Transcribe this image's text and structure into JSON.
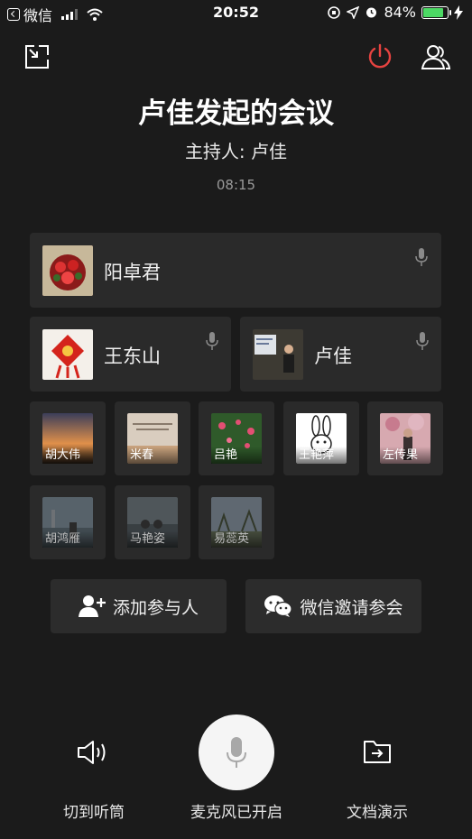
{
  "status_bar": {
    "back_app": "微信",
    "time": "20:52",
    "battery_percent": "84%",
    "battery_level": 0.84,
    "battery_color": "#4cd964"
  },
  "toolbar": {
    "minimize_icon": "minimize-window-icon",
    "power_icon": "power-icon",
    "power_color": "#e64340",
    "members_icon": "members-icon"
  },
  "meeting": {
    "title": "卢佳发起的会议",
    "host": "主持人: 卢佳",
    "timer": "08:15"
  },
  "speakers": {
    "primary": {
      "name": "阳卓君"
    },
    "secondary": [
      {
        "name": "王东山"
      },
      {
        "name": "卢佳"
      }
    ]
  },
  "participants": [
    {
      "name": "胡大伟",
      "dim": false
    },
    {
      "name": "米春",
      "dim": false
    },
    {
      "name": "吕艳",
      "dim": false
    },
    {
      "name": "王艳萍",
      "dim": false
    },
    {
      "name": "左传果",
      "dim": false
    },
    {
      "name": "胡鸿雁",
      "dim": true
    },
    {
      "name": "马艳姿",
      "dim": true
    },
    {
      "name": "易蕊英",
      "dim": true
    }
  ],
  "actions": {
    "add_participant": "添加参与人",
    "wechat_invite": "微信邀请参会"
  },
  "bottom": {
    "speaker_label": "切到听筒",
    "mic_label": "麦克风已开启",
    "doc_label": "文档演示"
  }
}
